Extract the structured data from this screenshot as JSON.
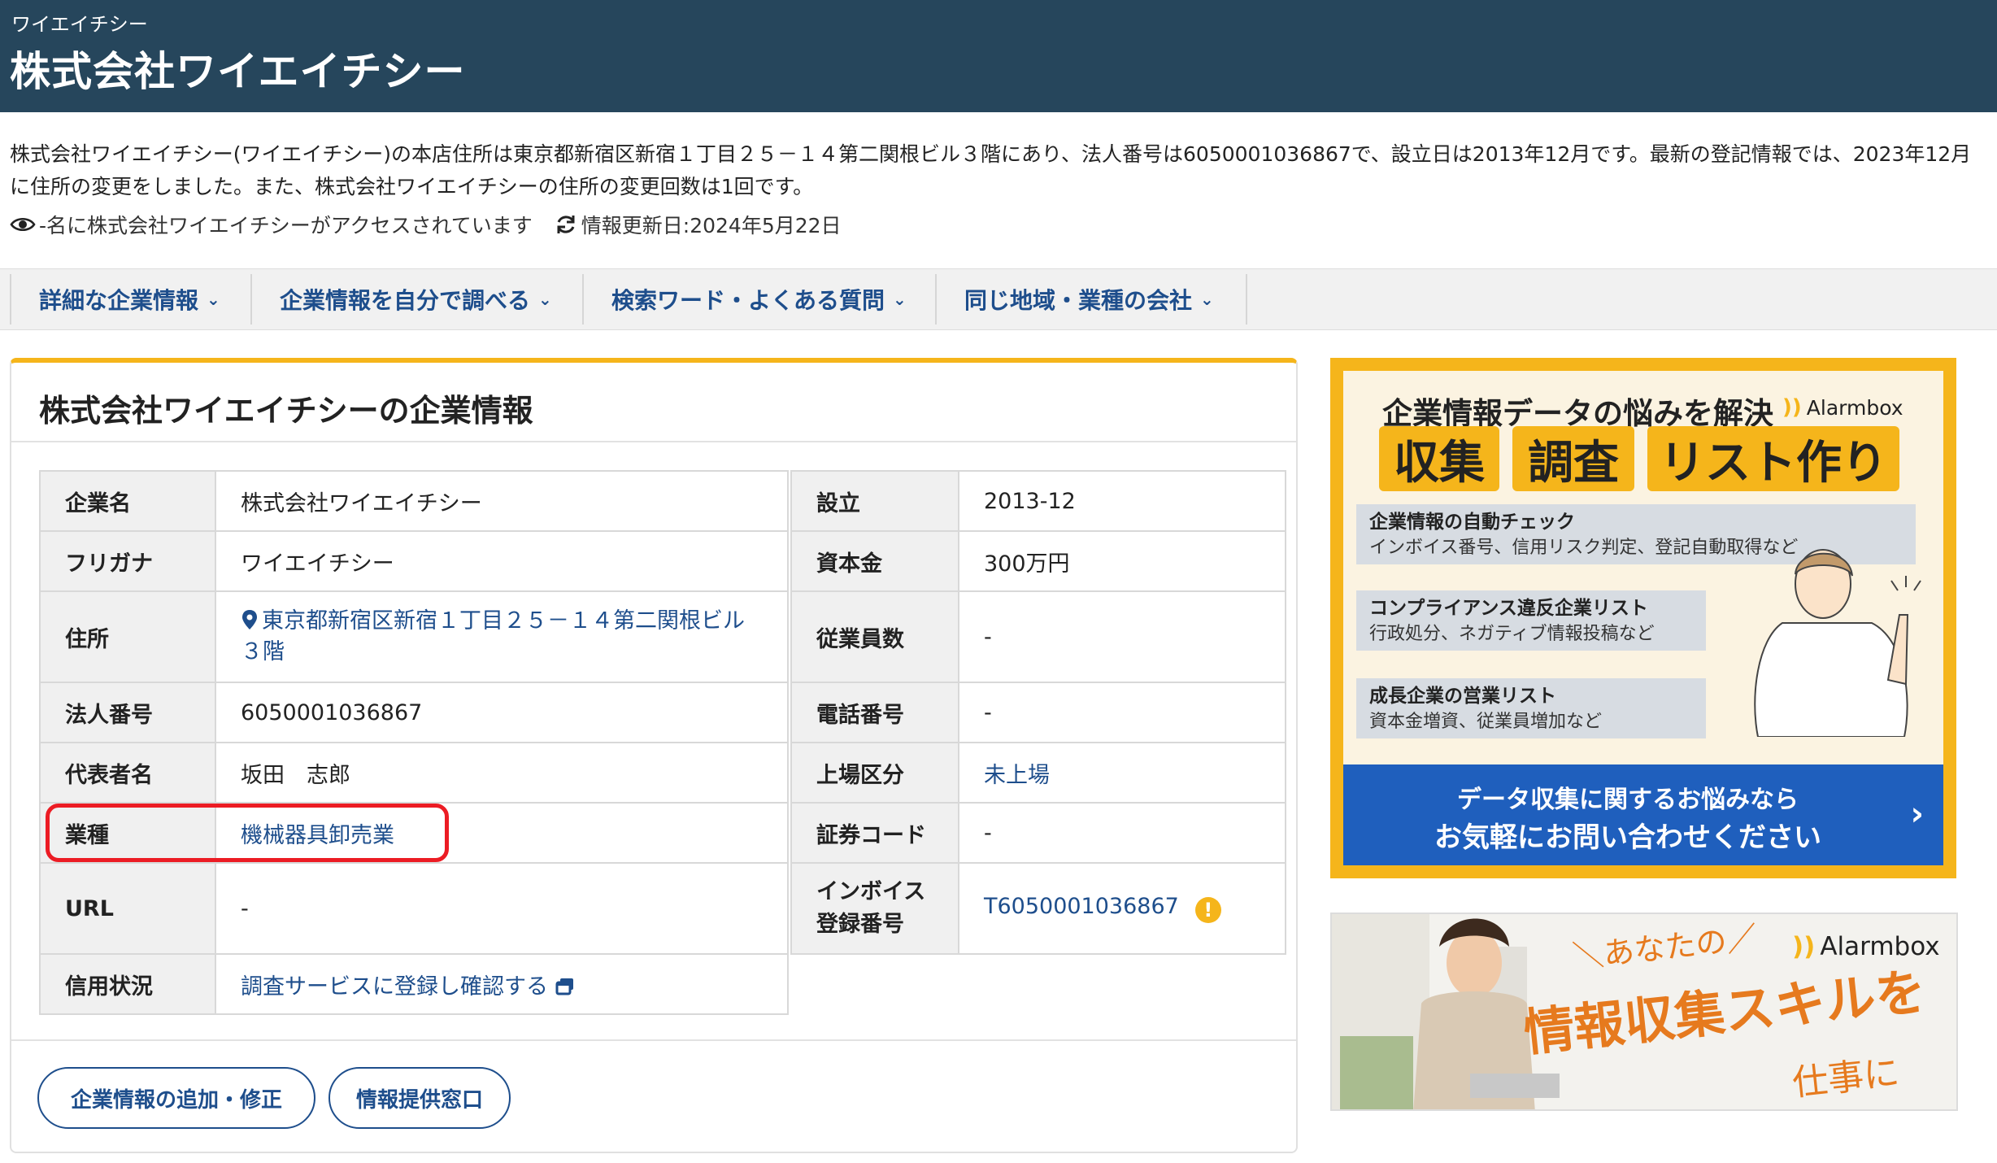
{
  "header": {
    "kana": "ワイエイチシー",
    "title": "株式会社ワイエイチシー"
  },
  "description": "株式会社ワイエイチシー(ワイエイチシー)の本店住所は東京都新宿区新宿１丁目２５－１４第二関根ビル３階にあり、法人番号は6050001036867で、設立日は2013年12月です。最新の登記情報では、2023年12月に住所の変更をしました。また、株式会社ワイエイチシーの住所の変更回数は1回です。",
  "meta": {
    "access_text": "-名に株式会社ワイエイチシーがアクセスされています",
    "updated_text": "情報更新日:2024年5月22日"
  },
  "nav": [
    {
      "label": "詳細な企業情報"
    },
    {
      "label": "企業情報を自分で調べる"
    },
    {
      "label": "検索ワード・よくある質問"
    },
    {
      "label": "同じ地域・業種の会社"
    }
  ],
  "card": {
    "title": "株式会社ワイエイチシーの企業情報",
    "left_table": [
      {
        "key": "企業名",
        "value": "株式会社ワイエイチシー"
      },
      {
        "key": "フリガナ",
        "value": "ワイエイチシー"
      },
      {
        "key": "住所",
        "value": "東京都新宿区新宿１丁目２５－１４第二関根ビル３階"
      },
      {
        "key": "法人番号",
        "value": "6050001036867"
      },
      {
        "key": "代表者名",
        "value": "坂田　志郎"
      },
      {
        "key": "業種",
        "value": "機械器具卸売業"
      },
      {
        "key": "URL",
        "value": "-"
      },
      {
        "key": "信用状況",
        "value": "調査サービスに登録し確認する"
      }
    ],
    "right_table": [
      {
        "key": "設立",
        "value": "2013-12"
      },
      {
        "key": "資本金",
        "value": "300万円"
      },
      {
        "key": "従業員数",
        "value": "-"
      },
      {
        "key": "電話番号",
        "value": "-"
      },
      {
        "key": "上場区分",
        "value": "未上場"
      },
      {
        "key": "証券コード",
        "value": "-"
      },
      {
        "key": "インボイス登録番号",
        "value": "T6050001036867"
      }
    ],
    "buttons": {
      "edit": "企業情報の追加・修正",
      "contact": "情報提供窓口"
    }
  },
  "ad1": {
    "heading": "企業情報データの悩みを解決",
    "brand": "Alarmbox",
    "boxes": [
      "収集",
      "調査",
      "リスト作り"
    ],
    "features": [
      {
        "title": "企業情報の自動チェック",
        "desc": "インボイス番号、信用リスク判定、登記自動取得など"
      },
      {
        "title": "コンプライアンス違反企業リスト",
        "desc": "行政処分、ネガティブ情報投稿など"
      },
      {
        "title": "成長企業の営業リスト",
        "desc": "資本金増資、従業員増加など"
      }
    ],
    "cta_line1": "データ収集に関するお悩みなら",
    "cta_line2": "お気軽にお問い合わせください",
    "accent": "#f5b51b",
    "cta_color": "#1f5fbd"
  },
  "ad2": {
    "brand": "Alarmbox",
    "line1": "＼あなたの／",
    "line2": "情報収集スキルを",
    "line3": "仕事に",
    "accent": "#e67a1e"
  },
  "colors": {
    "header_bg": "#26465c",
    "link": "#1e4e8c",
    "highlight": "#ec1c24"
  },
  "icons": [
    "eye-icon",
    "refresh-icon",
    "chevron-down-icon",
    "map-pin-icon",
    "external-window-icon",
    "warning-icon",
    "chevron-right-icon",
    "alarmbox-logo-icon"
  ]
}
